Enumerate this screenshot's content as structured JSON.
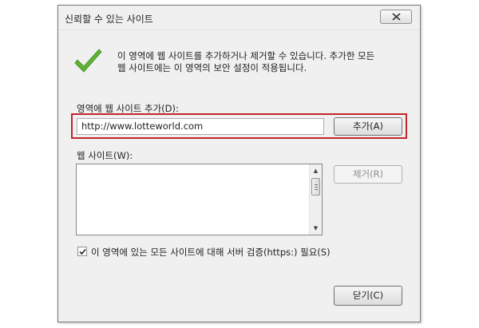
{
  "dialog": {
    "title": "신뢰할 수 있는 사이트",
    "info_line1": "이 영역에 웹 사이트를 추가하거나 제거할 수 있습니다. 추가한 모든",
    "info_line2": "웹 사이트에는 이 영역의 보안 설정이 적용됩니다.",
    "add_label": "영역에 웹 사이트 추가(D):",
    "url_value": "http://www.lotteworld.com",
    "add_button": "추가(A)",
    "websites_label": "웹 사이트(W):",
    "websites": [],
    "remove_button": "제거(R)",
    "https_checkbox_label": "이 영역에 있는 모든 사이트에 대해 서버 검증(https:) 필요(S)",
    "https_checked": true,
    "close_button": "닫기(C)"
  },
  "colors": {
    "highlight": "#c0262b",
    "check": "#5fb332"
  }
}
